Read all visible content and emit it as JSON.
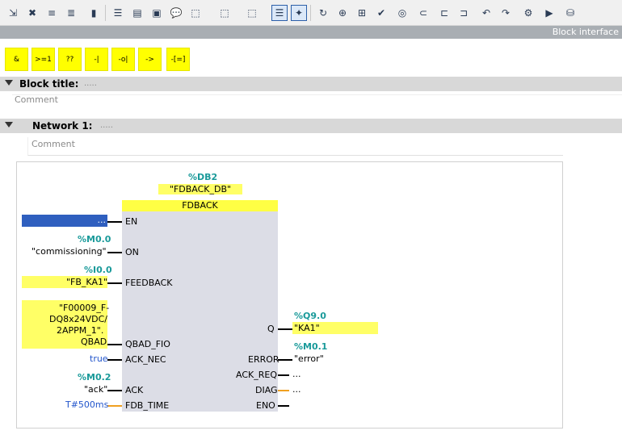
{
  "toolbar": {
    "icons": [
      "network-insert-icon",
      "network-delete-icon",
      "network-close-icon",
      "network-open-icon",
      "clear-icon",
      "absolute-operands-icon",
      "comments-icon",
      "network-comments-icon",
      "callout-icon",
      "favorites-add-icon",
      "favorites-remove-icon",
      "operand-display-icon",
      "show-favorites-icon",
      "highlight-icon",
      "go-to-icon",
      "monitor-icon",
      "modify-icon",
      "monitor-all-icon",
      "branch-open-icon",
      "branch-close-icon",
      "move-up-icon",
      "move-down-icon",
      "download-icon",
      "online-icon",
      "compare-icon"
    ]
  },
  "block_interface_label": "Block interface",
  "favorites": [
    "&",
    ">=1",
    "??",
    "-|",
    "-o|",
    "->",
    "-[=]"
  ],
  "block_title": {
    "label": "Block title:",
    "dots": ".....",
    "comment": "Comment"
  },
  "network": {
    "label": "Network 1:",
    "dots": ".....",
    "comment": "Comment"
  },
  "fb": {
    "instance_addr": "%DB2",
    "instance_name": "\"FDBACK_DB\"",
    "type": "FDBACK",
    "inputs": [
      {
        "pin": "EN",
        "addr": "",
        "value": "..."
      },
      {
        "pin": "ON",
        "addr": "%M0.0",
        "value": "\"commissioning\""
      },
      {
        "pin": "FEEDBACK",
        "addr": "%I0.0",
        "value": "\"FB_KA1\""
      },
      {
        "pin": "QBAD_FIO",
        "addr": "",
        "value": "\"F00009_F-DQ8x24VDC/2APPM_1\".QBAD"
      },
      {
        "pin": "ACK_NEC",
        "addr": "",
        "value": "true"
      },
      {
        "pin": "ACK",
        "addr": "%M0.2",
        "value": "\"ack\""
      },
      {
        "pin": "FDB_TIME",
        "addr": "",
        "value": "T#500ms"
      }
    ],
    "outputs": [
      {
        "pin": "Q",
        "addr": "%Q9.0",
        "value": "\"KA1\""
      },
      {
        "pin": "ERROR",
        "addr": "%M0.1",
        "value": "\"error\""
      },
      {
        "pin": "ACK_REQ",
        "addr": "",
        "value": "..."
      },
      {
        "pin": "DIAG",
        "addr": "",
        "value": "..."
      },
      {
        "pin": "ENO",
        "addr": "",
        "value": ""
      }
    ],
    "qbad_lines": [
      "\"F00009_F-",
      "DQ8x24VDC/",
      "2APPM_1\".",
      "QBAD"
    ]
  },
  "colors": {
    "address": "#1a9a9a",
    "highlight": "#ffff66",
    "constant": "#2255cc",
    "fb_body": "#dcdde6"
  }
}
